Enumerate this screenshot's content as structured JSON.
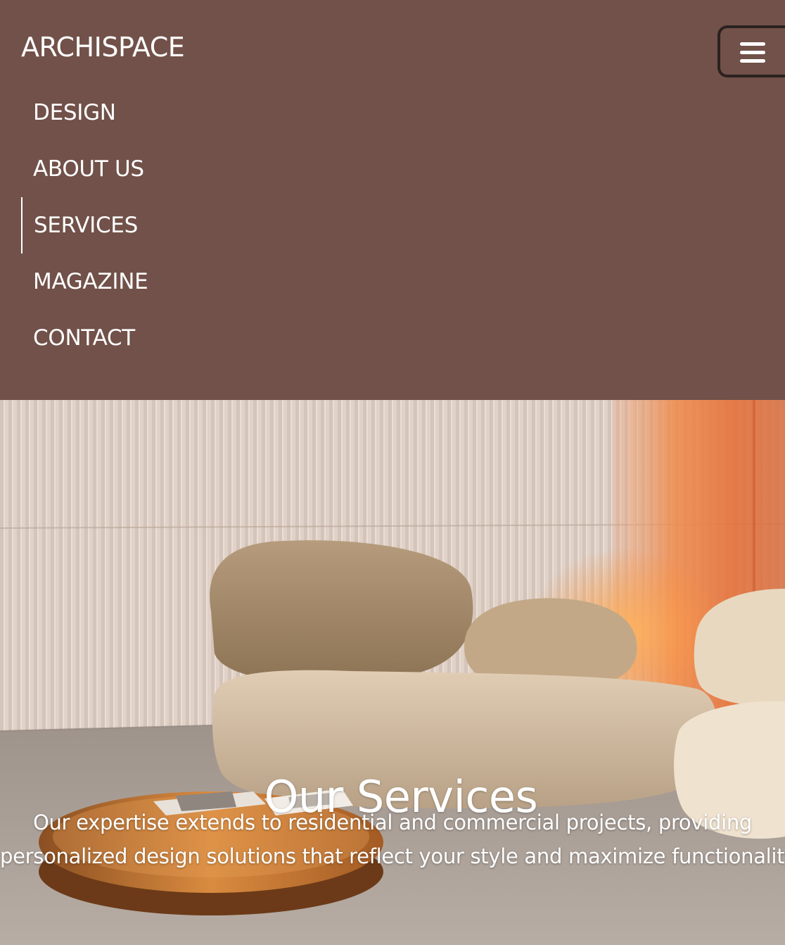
{
  "brand": {
    "name": "ARCHISPACE"
  },
  "nav": {
    "items": [
      {
        "label": "DESIGN",
        "active": false
      },
      {
        "label": "ABOUT US",
        "active": false
      },
      {
        "label": "SERVICES",
        "active": true
      },
      {
        "label": "MAGAZINE",
        "active": false
      },
      {
        "label": "CONTACT",
        "active": false
      }
    ],
    "toggler_icon": "hamburger-menu-icon"
  },
  "hero": {
    "title": "Our Services",
    "text_line1": "Our expertise extends to residential and commercial projects, providing",
    "text_line2": "personalized design solutions that reflect your style and maximize functionality"
  },
  "colors": {
    "nav_background": "#715149",
    "text": "#ffffff",
    "toggler_border": "#2a211f"
  }
}
